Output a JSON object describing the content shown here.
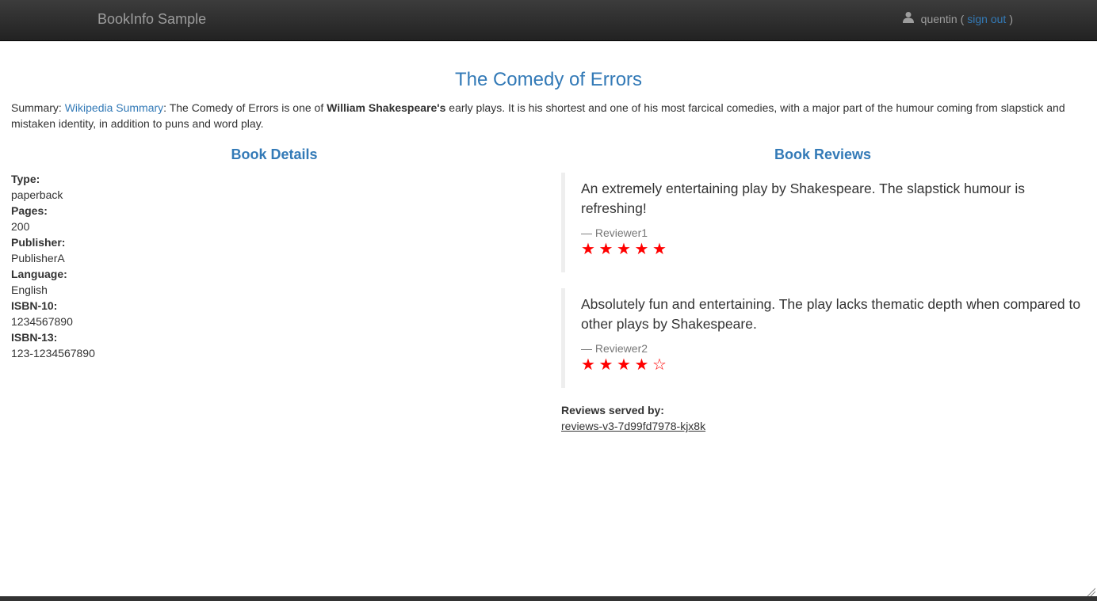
{
  "navbar": {
    "brand": "BookInfo Sample",
    "user_icon": "user-icon",
    "username": "quentin",
    "open_paren": "(",
    "signout_label": "sign out",
    "close_paren": ")"
  },
  "book": {
    "title": "The Comedy of Errors",
    "summary_label": "Summary: ",
    "summary_link": "Wikipedia Summary",
    "summary_pre": ": The Comedy of Errors is one of ",
    "summary_bold": "William Shakespeare's",
    "summary_post": " early plays. It is his shortest and one of his most farcical comedies, with a major part of the humour coming from slapstick and mistaken identity, in addition to puns and word play."
  },
  "details": {
    "heading": "Book Details",
    "items": [
      {
        "label": "Type:",
        "value": "paperback"
      },
      {
        "label": "Pages:",
        "value": "200"
      },
      {
        "label": "Publisher:",
        "value": "PublisherA"
      },
      {
        "label": "Language:",
        "value": "English"
      },
      {
        "label": "ISBN-10:",
        "value": "1234567890"
      },
      {
        "label": "ISBN-13:",
        "value": "123-1234567890"
      }
    ]
  },
  "reviews": {
    "heading": "Book Reviews",
    "star_color": "#ff0000",
    "items": [
      {
        "text": "An extremely entertaining play by Shakespeare. The slapstick humour is refreshing!",
        "author": "— Reviewer1",
        "rating": 5,
        "max_rating": 5
      },
      {
        "text": "Absolutely fun and entertaining. The play lacks thematic depth when compared to other plays by Shakespeare.",
        "author": "— Reviewer2",
        "rating": 4,
        "max_rating": 5
      }
    ],
    "served_by_label": "Reviews served by:",
    "served_by_value": "reviews-v3-7d99fd7978-kjx8k"
  }
}
